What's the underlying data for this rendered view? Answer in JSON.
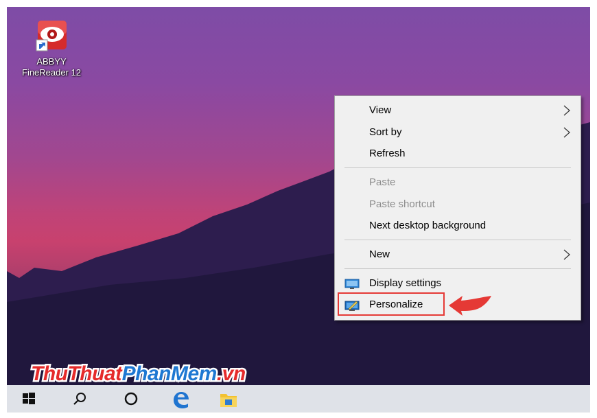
{
  "desktop": {
    "icons": [
      {
        "label": "ABBYY FineReader 12",
        "icon": "abbyy-finereader-icon"
      }
    ]
  },
  "context_menu": {
    "groups": [
      [
        {
          "label": "View",
          "submenu": true,
          "disabled": false
        },
        {
          "label": "Sort by",
          "submenu": true,
          "disabled": false
        },
        {
          "label": "Refresh",
          "submenu": false,
          "disabled": false
        }
      ],
      [
        {
          "label": "Paste",
          "submenu": false,
          "disabled": true
        },
        {
          "label": "Paste shortcut",
          "submenu": false,
          "disabled": true
        },
        {
          "label": "Next desktop background",
          "submenu": false,
          "disabled": false
        }
      ],
      [
        {
          "label": "New",
          "submenu": true,
          "disabled": false
        }
      ],
      [
        {
          "label": "Display settings",
          "submenu": false,
          "disabled": false,
          "icon": "display-settings-icon"
        },
        {
          "label": "Personalize",
          "submenu": false,
          "disabled": false,
          "icon": "personalize-icon",
          "highlighted": true
        }
      ]
    ],
    "highlight_color": "#e53935"
  },
  "watermark": {
    "parts": [
      {
        "text": "ThuThuat",
        "color": "#e52b2b"
      },
      {
        "text": "PhanMem",
        "color": "#1e78d2"
      },
      {
        "text": ".vn",
        "color": "#e52b2b"
      }
    ]
  },
  "taskbar": {
    "items": [
      "start-icon",
      "search-icon",
      "cortana-icon",
      "edge-icon",
      "file-explorer-icon"
    ]
  }
}
